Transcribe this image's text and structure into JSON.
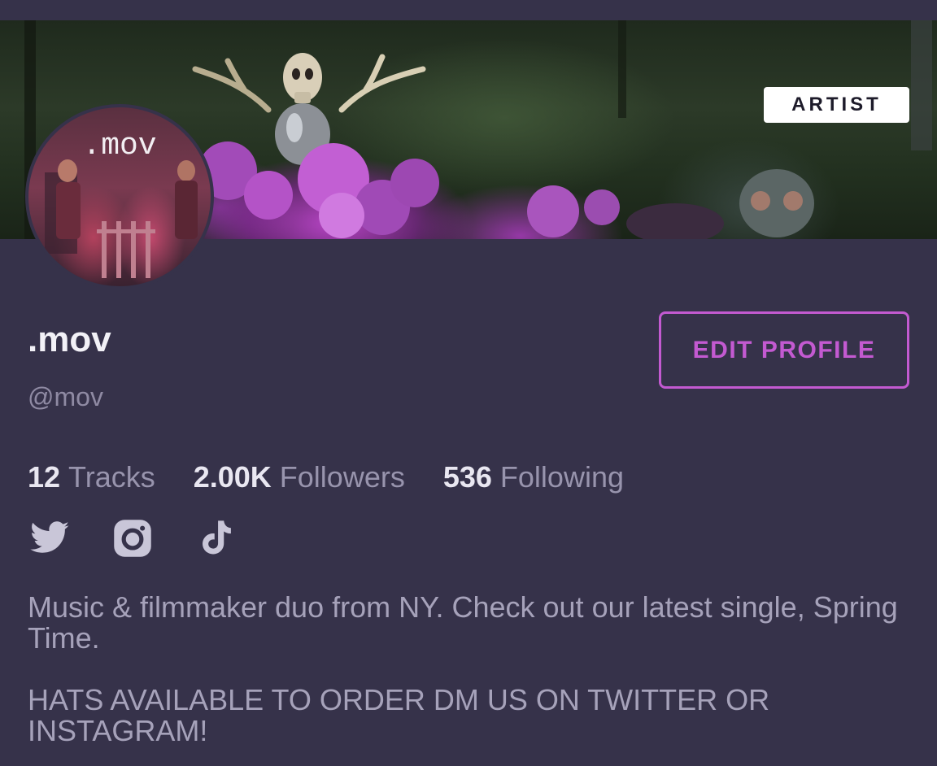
{
  "profile": {
    "badge": "ARTIST",
    "avatar_text": ".mov",
    "display_name": ".mov",
    "handle": "@mov",
    "edit_button": "EDIT PROFILE",
    "bio": "Music & filmmaker duo from NY. Check out our latest single, Spring Time.\n\nHATS AVAILABLE TO ORDER DM US ON TWITTER OR INSTAGRAM!"
  },
  "stats": [
    {
      "value": "12",
      "label": "Tracks"
    },
    {
      "value": "2.00K",
      "label": "Followers"
    },
    {
      "value": "536",
      "label": "Following"
    }
  ],
  "social_icons": [
    "twitter-icon",
    "instagram-icon",
    "tiktok-icon"
  ],
  "colors": {
    "background": "#36324a",
    "accent": "#c35ad1",
    "icon": "#c9c6d8"
  }
}
